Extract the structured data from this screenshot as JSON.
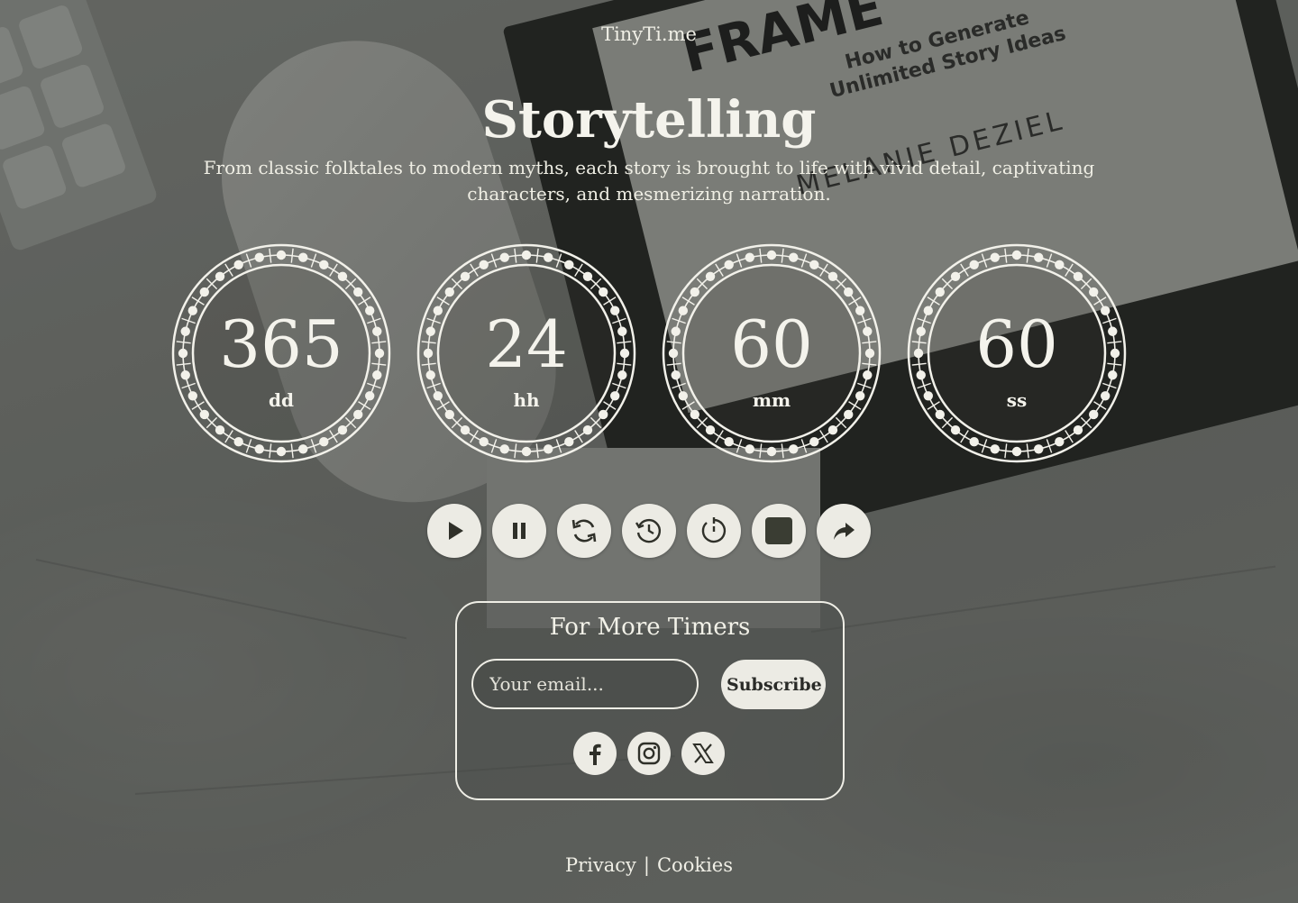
{
  "brand": "TinyTi.me",
  "title": "Storytelling",
  "subtitle": "From classic folktales to modern myths, each story is brought to life with vivid detail, captivating characters, and mesmerizing narration.",
  "background": {
    "book_lines": [
      "FRAME",
      "How to Generate",
      "Unlimited Story Ideas",
      "MELANIE DEZIEL"
    ]
  },
  "timer": {
    "days": {
      "value": "365",
      "unit": "dd"
    },
    "hours": {
      "value": "24",
      "unit": "hh"
    },
    "minutes": {
      "value": "60",
      "unit": "mm"
    },
    "seconds": {
      "value": "60",
      "unit": "ss"
    }
  },
  "controls": [
    {
      "name": "play-button",
      "icon": "play-icon"
    },
    {
      "name": "pause-button",
      "icon": "pause-icon"
    },
    {
      "name": "restart-button",
      "icon": "refresh-icon"
    },
    {
      "name": "history-button",
      "icon": "history-icon"
    },
    {
      "name": "timer-reset-button",
      "icon": "timer-icon"
    },
    {
      "name": "stop-button",
      "icon": "stop-icon"
    },
    {
      "name": "share-button",
      "icon": "share-icon"
    }
  ],
  "newsletter": {
    "title": "For More Timers",
    "email_placeholder": "Your email...",
    "subscribe_label": "Subscribe",
    "social": [
      "facebook-icon",
      "instagram-icon",
      "x-icon"
    ]
  },
  "footer": {
    "privacy": "Privacy",
    "separator": "|",
    "cookies": "Cookies"
  },
  "colors": {
    "accent": "#ecebe4",
    "text": "#f4f3ec",
    "icon_dark": "#2f3029",
    "stop_fill": "#3a3d33"
  }
}
